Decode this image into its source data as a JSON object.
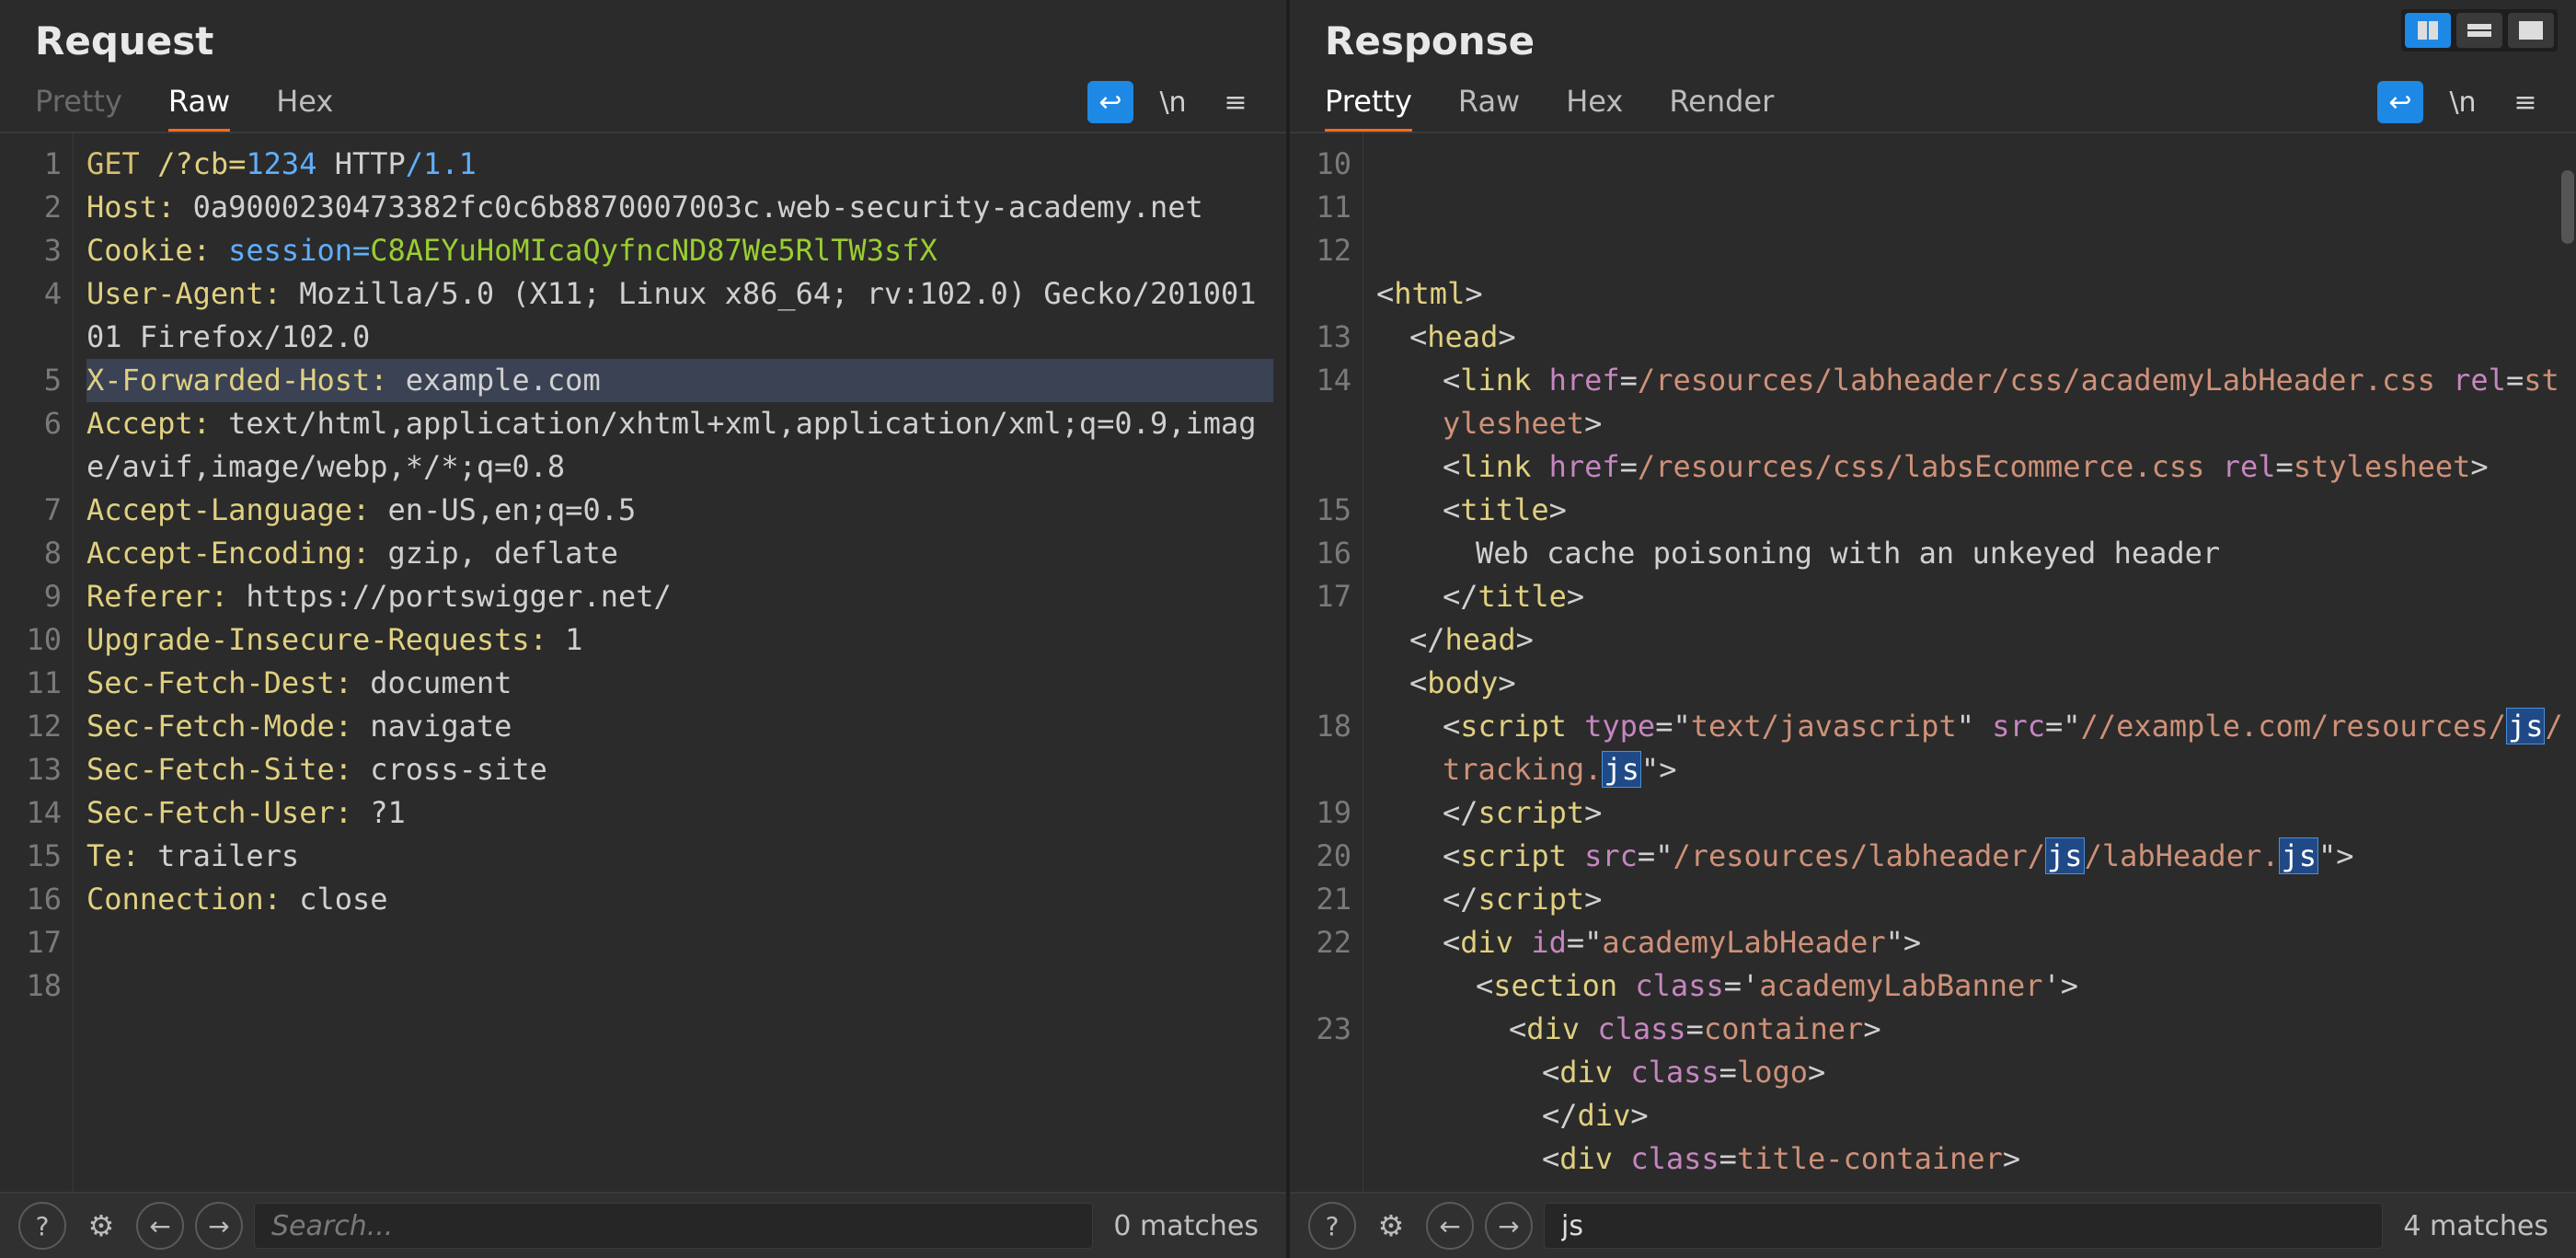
{
  "panes": {
    "request": {
      "title": "Request",
      "tabs": [
        "Pretty",
        "Raw",
        "Hex"
      ],
      "activeTab": "Raw",
      "disabledTab": "Pretty",
      "lineStart": 1,
      "lines": [
        {
          "n": 1,
          "segs": [
            {
              "t": "GET ",
              "c": "method"
            },
            {
              "t": "/?cb=",
              "c": "hk"
            },
            {
              "t": "1234",
              "c": "num"
            },
            {
              "t": " HTTP",
              "c": "hv"
            },
            {
              "t": "/1.1",
              "c": "num"
            }
          ]
        },
        {
          "n": 2,
          "segs": [
            {
              "t": "Host:",
              "c": "hk"
            },
            {
              "t": " 0a9000230473382fc0c6b8870007003c.web-security-academy.net",
              "c": "hv"
            }
          ]
        },
        {
          "n": 3,
          "segs": [
            {
              "t": "Cookie:",
              "c": "hk"
            },
            {
              "t": " session=",
              "c": "num"
            },
            {
              "t": "C8AEYuHoMIcaQyfncND87We5RlTW3sfX",
              "c": "cookie"
            }
          ]
        },
        {
          "n": 4,
          "segs": [
            {
              "t": "User-Agent:",
              "c": "hk"
            },
            {
              "t": " Mozilla/5.0 (X11; Linux x86_64; rv:102.0) Gecko/20100101 Firefox/102.0",
              "c": "hv"
            }
          ]
        },
        {
          "n": 5,
          "hl": true,
          "segs": [
            {
              "t": "X-Forwarded-Host:",
              "c": "hk"
            },
            {
              "t": " example.com",
              "c": "hv"
            }
          ]
        },
        {
          "n": 6,
          "segs": [
            {
              "t": "Accept:",
              "c": "hk"
            },
            {
              "t": " text/html,application/xhtml+xml,application/xml;q=0.9,image/avif,image/webp,*/*;q=0.8",
              "c": "hv"
            }
          ]
        },
        {
          "n": 7,
          "segs": [
            {
              "t": "Accept-Language:",
              "c": "hk"
            },
            {
              "t": " en-US,en;q=0.5",
              "c": "hv"
            }
          ]
        },
        {
          "n": 8,
          "segs": [
            {
              "t": "Accept-Encoding:",
              "c": "hk"
            },
            {
              "t": " gzip, deflate",
              "c": "hv"
            }
          ]
        },
        {
          "n": 9,
          "segs": [
            {
              "t": "Referer:",
              "c": "hk"
            },
            {
              "t": " https://portswigger.net/",
              "c": "hv"
            }
          ]
        },
        {
          "n": 10,
          "segs": [
            {
              "t": "Upgrade-Insecure-Requests:",
              "c": "hk"
            },
            {
              "t": " 1",
              "c": "hv"
            }
          ]
        },
        {
          "n": 11,
          "segs": [
            {
              "t": "Sec-Fetch-Dest:",
              "c": "hk"
            },
            {
              "t": " document",
              "c": "hv"
            }
          ]
        },
        {
          "n": 12,
          "segs": [
            {
              "t": "Sec-Fetch-Mode:",
              "c": "hk"
            },
            {
              "t": " navigate",
              "c": "hv"
            }
          ]
        },
        {
          "n": 13,
          "segs": [
            {
              "t": "Sec-Fetch-Site:",
              "c": "hk"
            },
            {
              "t": " cross-site",
              "c": "hv"
            }
          ]
        },
        {
          "n": 14,
          "segs": [
            {
              "t": "Sec-Fetch-User:",
              "c": "hk"
            },
            {
              "t": " ?1",
              "c": "hv"
            }
          ]
        },
        {
          "n": 15,
          "segs": [
            {
              "t": "Te:",
              "c": "hk"
            },
            {
              "t": " trailers",
              "c": "hv"
            }
          ]
        },
        {
          "n": 16,
          "segs": [
            {
              "t": "Connection:",
              "c": "hk"
            },
            {
              "t": " close",
              "c": "hv"
            }
          ]
        },
        {
          "n": 17,
          "segs": []
        },
        {
          "n": 18,
          "segs": []
        }
      ],
      "search": {
        "value": "",
        "placeholder": "Search...",
        "matches": "0 matches"
      }
    },
    "response": {
      "title": "Response",
      "tabs": [
        "Pretty",
        "Raw",
        "Hex",
        "Render"
      ],
      "activeTab": "Pretty",
      "lineStart": 10,
      "lines": [
        {
          "n": 10,
          "segs": [
            {
              "t": "<",
              "c": "hv"
            },
            {
              "t": "html",
              "c": "hk"
            },
            {
              "t": ">",
              "c": "hv"
            }
          ],
          "cut": true
        },
        {
          "n": 11,
          "pad": 1,
          "segs": [
            {
              "t": "<",
              "c": "hv"
            },
            {
              "t": "head",
              "c": "hk"
            },
            {
              "t": ">",
              "c": "hv"
            }
          ]
        },
        {
          "n": 12,
          "pad": 2,
          "segs": [
            {
              "t": "<",
              "c": "hv"
            },
            {
              "t": "link",
              "c": "hk"
            },
            {
              "t": " ",
              "c": "hv"
            },
            {
              "t": "href",
              "c": "attr"
            },
            {
              "t": "=",
              "c": "hv"
            },
            {
              "t": "/resources/labheader/css/academyLabHeader.css",
              "c": "str"
            },
            {
              "t": " ",
              "c": "hv"
            },
            {
              "t": "rel",
              "c": "attr"
            },
            {
              "t": "=",
              "c": "hv"
            },
            {
              "t": "stylesheet",
              "c": "str"
            },
            {
              "t": ">",
              "c": "hv"
            }
          ]
        },
        {
          "n": 13,
          "pad": 2,
          "segs": [
            {
              "t": "<",
              "c": "hv"
            },
            {
              "t": "link",
              "c": "hk"
            },
            {
              "t": " ",
              "c": "hv"
            },
            {
              "t": "href",
              "c": "attr"
            },
            {
              "t": "=",
              "c": "hv"
            },
            {
              "t": "/resources/css/labsEcommerce.css",
              "c": "str"
            },
            {
              "t": " ",
              "c": "hv"
            },
            {
              "t": "rel",
              "c": "attr"
            },
            {
              "t": "=",
              "c": "hv"
            },
            {
              "t": "stylesheet",
              "c": "str"
            },
            {
              "t": ">",
              "c": "hv"
            }
          ]
        },
        {
          "n": 14,
          "pad": 2,
          "segs": [
            {
              "t": "<",
              "c": "hv"
            },
            {
              "t": "title",
              "c": "hk"
            },
            {
              "t": ">",
              "c": "hv"
            }
          ]
        },
        {
          "n": "",
          "pad": 3,
          "segs": [
            {
              "t": "Web cache poisoning with an unkeyed header",
              "c": "hv"
            }
          ]
        },
        {
          "n": "",
          "pad": 2,
          "segs": [
            {
              "t": "</",
              "c": "hv"
            },
            {
              "t": "title",
              "c": "hk"
            },
            {
              "t": ">",
              "c": "hv"
            }
          ]
        },
        {
          "n": 15,
          "pad": 1,
          "segs": [
            {
              "t": "</",
              "c": "hv"
            },
            {
              "t": "head",
              "c": "hk"
            },
            {
              "t": ">",
              "c": "hv"
            }
          ]
        },
        {
          "n": 16,
          "pad": 1,
          "segs": [
            {
              "t": "<",
              "c": "hv"
            },
            {
              "t": "body",
              "c": "hk"
            },
            {
              "t": ">",
              "c": "hv"
            }
          ]
        },
        {
          "n": 17,
          "pad": 2,
          "segs": [
            {
              "t": "<",
              "c": "hv"
            },
            {
              "t": "script",
              "c": "hk"
            },
            {
              "t": " ",
              "c": "hv"
            },
            {
              "t": "type",
              "c": "attr"
            },
            {
              "t": "=\"",
              "c": "hv"
            },
            {
              "t": "text/javascript",
              "c": "str"
            },
            {
              "t": "\" ",
              "c": "hv"
            },
            {
              "t": "src",
              "c": "attr"
            },
            {
              "t": "=\"",
              "c": "hv"
            },
            {
              "t": "//example.com/resources/",
              "c": "str"
            },
            {
              "t": "js",
              "c": "match"
            },
            {
              "t": "/tracking.",
              "c": "str"
            },
            {
              "t": "js",
              "c": "match"
            },
            {
              "t": "\">",
              "c": "hv"
            }
          ]
        },
        {
          "n": "",
          "pad": 2,
          "segs": [
            {
              "t": "</",
              "c": "hv"
            },
            {
              "t": "script",
              "c": "hk"
            },
            {
              "t": ">",
              "c": "hv"
            }
          ]
        },
        {
          "n": 18,
          "pad": 2,
          "segs": [
            {
              "t": "<",
              "c": "hv"
            },
            {
              "t": "script",
              "c": "hk"
            },
            {
              "t": " ",
              "c": "hv"
            },
            {
              "t": "src",
              "c": "attr"
            },
            {
              "t": "=\"",
              "c": "hv"
            },
            {
              "t": "/resources/labheader/",
              "c": "str"
            },
            {
              "t": "js",
              "c": "match"
            },
            {
              "t": "/labHeader.",
              "c": "str"
            },
            {
              "t": "js",
              "c": "match"
            },
            {
              "t": "\">",
              "c": "hv"
            }
          ]
        },
        {
          "n": "",
          "pad": 2,
          "segs": [
            {
              "t": "</",
              "c": "hv"
            },
            {
              "t": "script",
              "c": "hk"
            },
            {
              "t": ">",
              "c": "hv"
            }
          ]
        },
        {
          "n": 19,
          "pad": 2,
          "segs": [
            {
              "t": "<",
              "c": "hv"
            },
            {
              "t": "div",
              "c": "hk"
            },
            {
              "t": " ",
              "c": "hv"
            },
            {
              "t": "id",
              "c": "attr"
            },
            {
              "t": "=\"",
              "c": "hv"
            },
            {
              "t": "academyLabHeader",
              "c": "str"
            },
            {
              "t": "\">",
              "c": "hv"
            }
          ]
        },
        {
          "n": 20,
          "pad": 3,
          "segs": [
            {
              "t": "<",
              "c": "hv"
            },
            {
              "t": "section",
              "c": "hk"
            },
            {
              "t": " ",
              "c": "hv"
            },
            {
              "t": "class",
              "c": "attr"
            },
            {
              "t": "='",
              "c": "hv"
            },
            {
              "t": "academyLabBanner",
              "c": "str"
            },
            {
              "t": "'>",
              "c": "hv"
            }
          ]
        },
        {
          "n": 21,
          "pad": 4,
          "segs": [
            {
              "t": "<",
              "c": "hv"
            },
            {
              "t": "div",
              "c": "hk"
            },
            {
              "t": " ",
              "c": "hv"
            },
            {
              "t": "class",
              "c": "attr"
            },
            {
              "t": "=",
              "c": "hv"
            },
            {
              "t": "container",
              "c": "str"
            },
            {
              "t": ">",
              "c": "hv"
            }
          ]
        },
        {
          "n": 22,
          "pad": 5,
          "segs": [
            {
              "t": "<",
              "c": "hv"
            },
            {
              "t": "div",
              "c": "hk"
            },
            {
              "t": " ",
              "c": "hv"
            },
            {
              "t": "class",
              "c": "attr"
            },
            {
              "t": "=",
              "c": "hv"
            },
            {
              "t": "logo",
              "c": "str"
            },
            {
              "t": ">",
              "c": "hv"
            }
          ]
        },
        {
          "n": "",
          "pad": 5,
          "segs": [
            {
              "t": "</",
              "c": "hv"
            },
            {
              "t": "div",
              "c": "hk"
            },
            {
              "t": ">",
              "c": "hv"
            }
          ]
        },
        {
          "n": 23,
          "pad": 5,
          "segs": [
            {
              "t": "<",
              "c": "hv"
            },
            {
              "t": "div",
              "c": "hk"
            },
            {
              "t": " ",
              "c": "hv"
            },
            {
              "t": "class",
              "c": "attr"
            },
            {
              "t": "=",
              "c": "hv"
            },
            {
              "t": "title-container",
              "c": "str"
            },
            {
              "t": ">",
              "c": "hv"
            }
          ],
          "cut": true
        }
      ],
      "search": {
        "value": "js",
        "placeholder": "Search...",
        "matches": "4 matches"
      }
    }
  },
  "icons": {
    "wrap": "↩",
    "newline": "\\n",
    "menu": "≡",
    "help": "?",
    "gear": "⚙",
    "left": "←",
    "right": "→"
  }
}
